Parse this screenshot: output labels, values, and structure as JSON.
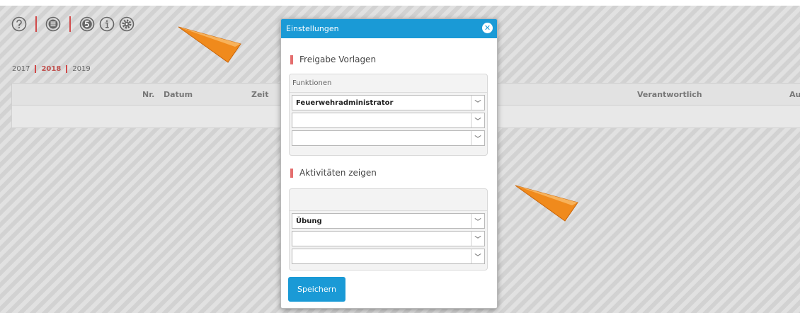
{
  "toolbar": {
    "icons": [
      "help-icon",
      "list-icon",
      "number-five-icon",
      "info-icon",
      "gear-icon"
    ],
    "separator_color": "#d14a4a"
  },
  "years": {
    "items": [
      "2017",
      "2018",
      "2019"
    ],
    "active": "2018"
  },
  "table": {
    "columns": [
      "Nr.",
      "Datum",
      "Zeit",
      "Verantwortlich",
      "Au"
    ]
  },
  "modal": {
    "title": "Einstellungen",
    "close_symbol": "✕",
    "section1": {
      "title": "Freigabe Vorlagen",
      "panel_header": "Funktionen",
      "selects": [
        "Feuerwehradministrator",
        "",
        ""
      ]
    },
    "section2": {
      "title": "Aktivitäten zeigen",
      "panel_header": "",
      "selects": [
        "Übung",
        "",
        ""
      ]
    },
    "save_label": "Speichern"
  },
  "colors": {
    "accent": "#1a9ad6",
    "section_marker": "#e46e6e",
    "active_year": "#c0504d",
    "pointer_arrow": "#f08a1c"
  }
}
